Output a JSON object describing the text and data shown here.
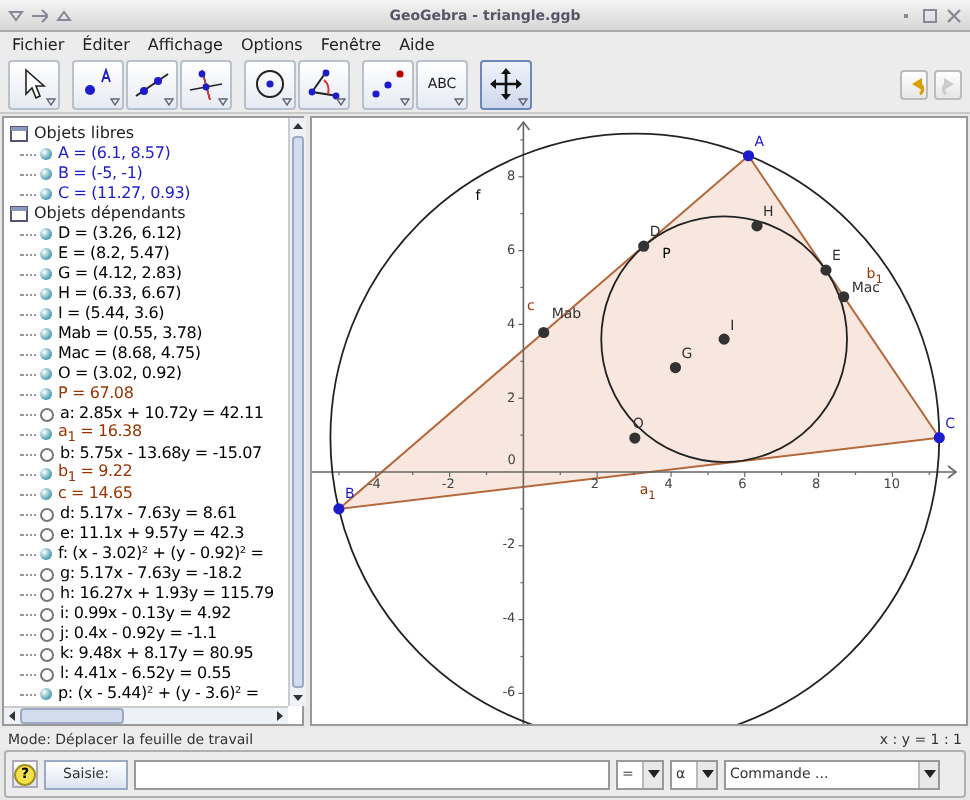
{
  "window": {
    "title": "GeoGebra - triangle.ggb"
  },
  "menu": [
    "Fichier",
    "Éditer",
    "Affichage",
    "Options",
    "Fenêtre",
    "Aide"
  ],
  "toolbar": {
    "groups": [
      [
        {
          "kind": "pointer",
          "selected": false
        }
      ],
      [
        {
          "kind": "point",
          "selected": false
        },
        {
          "kind": "line",
          "selected": false
        },
        {
          "kind": "perpendicular",
          "selected": false
        }
      ],
      [
        {
          "kind": "circle",
          "selected": false
        },
        {
          "kind": "angle",
          "selected": false
        }
      ],
      [
        {
          "kind": "reflect",
          "selected": false
        },
        {
          "kind": "text",
          "label": "ABC",
          "selected": false
        }
      ],
      [
        {
          "kind": "move",
          "selected": true
        }
      ]
    ],
    "history": [
      {
        "kind": "undo",
        "disabled": false
      },
      {
        "kind": "redo",
        "disabled": true
      }
    ]
  },
  "algebra": {
    "groups": [
      {
        "label": "Objets libres",
        "expanded": true,
        "items": [
          {
            "text": "A = (6.1, 8.57)",
            "shown": true,
            "color": "#1c1ccc"
          },
          {
            "text": "B = (-5, -1)",
            "shown": true,
            "color": "#1c1ccc"
          },
          {
            "text": "C = (11.27, 0.93)",
            "shown": true,
            "color": "#1c1ccc"
          }
        ]
      },
      {
        "label": "Objets dépendants",
        "expanded": true,
        "items": [
          {
            "text": "D = (3.26, 6.12)",
            "shown": true,
            "color": "#000000"
          },
          {
            "text": "E = (8.2, 5.47)",
            "shown": true,
            "color": "#000000"
          },
          {
            "text": "G = (4.12, 2.83)",
            "shown": true,
            "color": "#000000"
          },
          {
            "text": "H = (6.33, 6.67)",
            "shown": true,
            "color": "#000000"
          },
          {
            "text": "I = (5.44, 3.6)",
            "shown": true,
            "color": "#000000"
          },
          {
            "text": "Mab = (0.55, 3.78)",
            "shown": true,
            "color": "#000000"
          },
          {
            "text": "Mac = (8.68, 4.75)",
            "shown": true,
            "color": "#000000"
          },
          {
            "text": "O = (3.02, 0.92)",
            "shown": true,
            "color": "#000000"
          },
          {
            "text": "P = 67.08",
            "shown": true,
            "color": "#993300"
          },
          {
            "text": "a: 2.85x + 10.72y = 42.11",
            "shown": false,
            "color": "#000000"
          },
          {
            "text": "a$_{1}$ = 16.38",
            "shown": true,
            "color": "#993300"
          },
          {
            "text": "b: 5.75x - 13.68y = -15.07",
            "shown": false,
            "color": "#000000"
          },
          {
            "text": "b$_{1}$ = 9.22",
            "shown": true,
            "color": "#993300"
          },
          {
            "text": "c = 14.65",
            "shown": true,
            "color": "#993300"
          },
          {
            "text": "d: 5.17x - 7.63y = 8.61",
            "shown": false,
            "color": "#000000"
          },
          {
            "text": "e: 11.1x + 9.57y = 42.3",
            "shown": false,
            "color": "#000000"
          },
          {
            "text": "f: (x - 3.02)² + (y - 0.92)² =",
            "shown": true,
            "color": "#000000"
          },
          {
            "text": "g: 5.17x - 7.63y = -18.2",
            "shown": false,
            "color": "#000000"
          },
          {
            "text": "h: 16.27x + 1.93y = 115.79",
            "shown": false,
            "color": "#000000"
          },
          {
            "text": "i: 0.99x - 0.13y = 4.92",
            "shown": false,
            "color": "#000000"
          },
          {
            "text": "j: 0.4x - 0.92y = -1.1",
            "shown": false,
            "color": "#000000"
          },
          {
            "text": "k: 9.48x + 8.17y = 80.95",
            "shown": false,
            "color": "#000000"
          },
          {
            "text": "l: 4.41x - 6.52y = 0.55",
            "shown": false,
            "color": "#000000"
          },
          {
            "text": "p: (x - 5.44)² + (y - 3.6)² =",
            "shown": true,
            "color": "#000000"
          }
        ]
      }
    ]
  },
  "canvas": {
    "xticks": [
      "-4",
      "-2",
      "2",
      "4",
      "6",
      "8",
      "10"
    ],
    "yticks": [
      "8",
      "6",
      "4",
      "2",
      "-2",
      "-4",
      "-6"
    ],
    "origin_label": "0",
    "points": [
      {
        "label": "A",
        "color": "#1c1ccc"
      },
      {
        "label": "B",
        "color": "#1c1ccc"
      },
      {
        "label": "C",
        "color": "#1c1ccc"
      },
      {
        "label": "D",
        "color": "#333333"
      },
      {
        "label": "E",
        "color": "#333333"
      },
      {
        "label": "G",
        "color": "#333333"
      },
      {
        "label": "H",
        "color": "#333333"
      },
      {
        "label": "I",
        "color": "#333333"
      },
      {
        "label": "Mab",
        "color": "#333333"
      },
      {
        "label": "Mac",
        "color": "#333333"
      },
      {
        "label": "O",
        "color": "#333333"
      }
    ],
    "labels": [
      {
        "text": "P",
        "color": "#000000"
      },
      {
        "text": "f",
        "color": "#000000"
      },
      {
        "text": "c",
        "color": "#993300"
      },
      {
        "text": "b$_{1}$",
        "color": "#993300"
      },
      {
        "text": "a$_{1}$",
        "color": "#993300"
      }
    ]
  },
  "status": {
    "mode": "Mode: Déplacer la feuille de travail",
    "ratio": "x : y = 1 : 1"
  },
  "input_bar": {
    "help": "?",
    "button": "Saisie:",
    "symbol_combo": "=",
    "greek_combo": "α",
    "command_combo": "Commande ..."
  }
}
